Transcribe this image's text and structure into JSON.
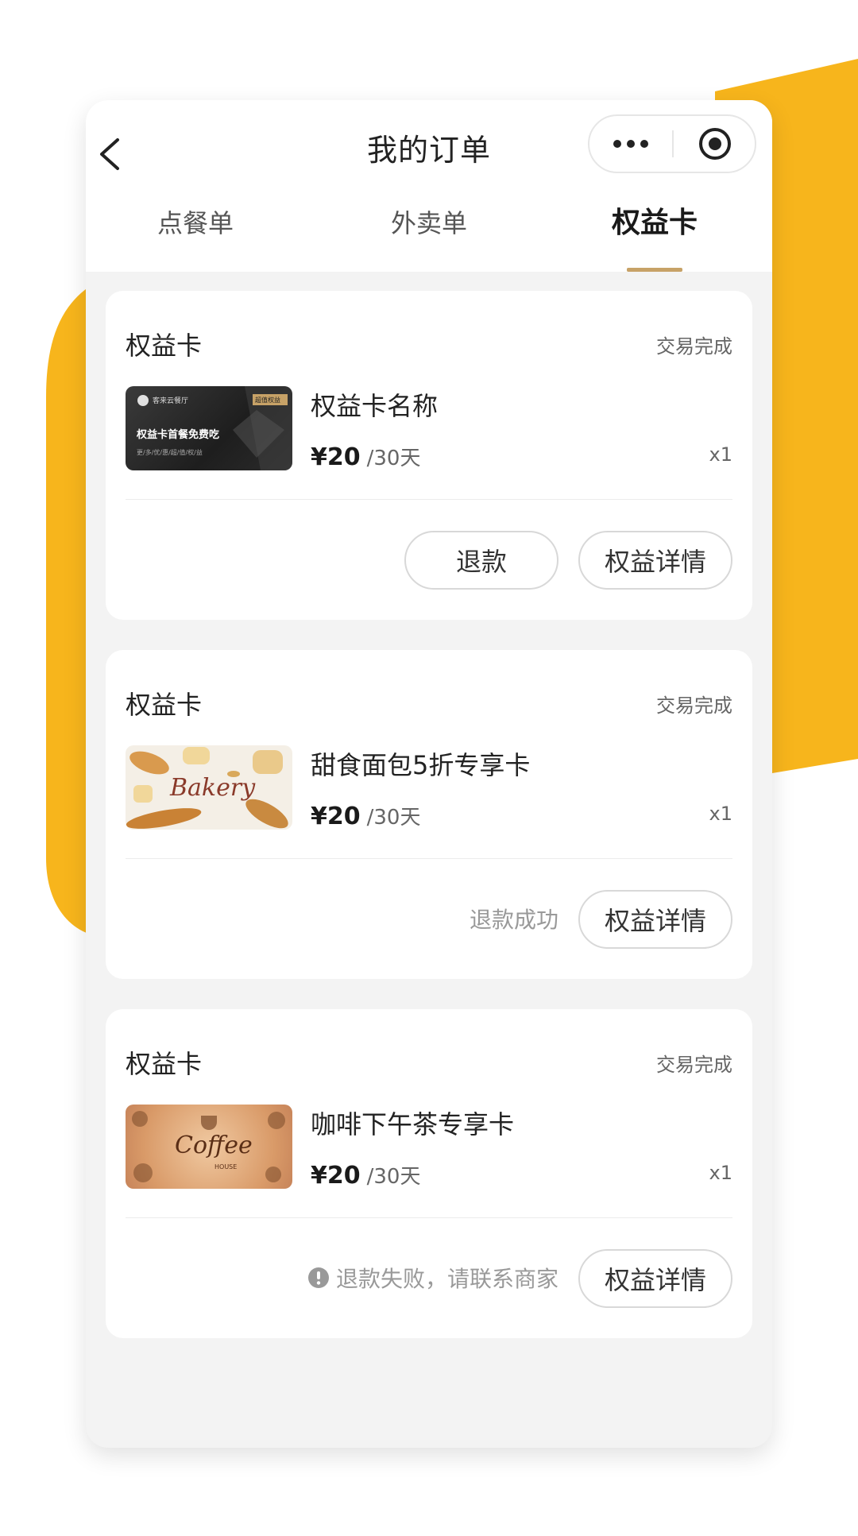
{
  "header": {
    "title": "我的订单",
    "back_icon": "chevron-left-icon",
    "more_icon": "more-dots-icon",
    "close_icon": "target-close-icon"
  },
  "tabs": [
    {
      "label": "点餐单",
      "active": false
    },
    {
      "label": "外卖单",
      "active": false
    },
    {
      "label": "权益卡",
      "active": true
    }
  ],
  "orders": [
    {
      "label": "权益卡",
      "status": "交易完成",
      "name": "权益卡名称",
      "price": "¥20",
      "period": "/30天",
      "qty": "x1",
      "thumb": {
        "brand": "客来云餐厅",
        "badge": "超值权益",
        "title": "权益卡首餐免费吃",
        "subtitle": "更/多/优/惠/超/值/权/益"
      },
      "refund_button": "退款",
      "detail_button": "权益详情"
    },
    {
      "label": "权益卡",
      "status": "交易完成",
      "name": "甜食面包5折专享卡",
      "price": "¥20",
      "period": "/30天",
      "qty": "x1",
      "thumb": {
        "script_text": "Bakery"
      },
      "note": "退款成功",
      "detail_button": "权益详情"
    },
    {
      "label": "权益卡",
      "status": "交易完成",
      "name": "咖啡下午茶专享卡",
      "price": "¥20",
      "period": "/30天",
      "qty": "x1",
      "thumb": {
        "script_text": "Coffee",
        "small_text": "HOUSE"
      },
      "note": "退款失败，请联系商家",
      "note_icon": "exclamation-circle-icon",
      "detail_button": "权益详情"
    }
  ],
  "colors": {
    "accent_gold": "#c7a267",
    "brand_yellow": "#f7b51c",
    "page_bg": "#f3f3f3"
  }
}
